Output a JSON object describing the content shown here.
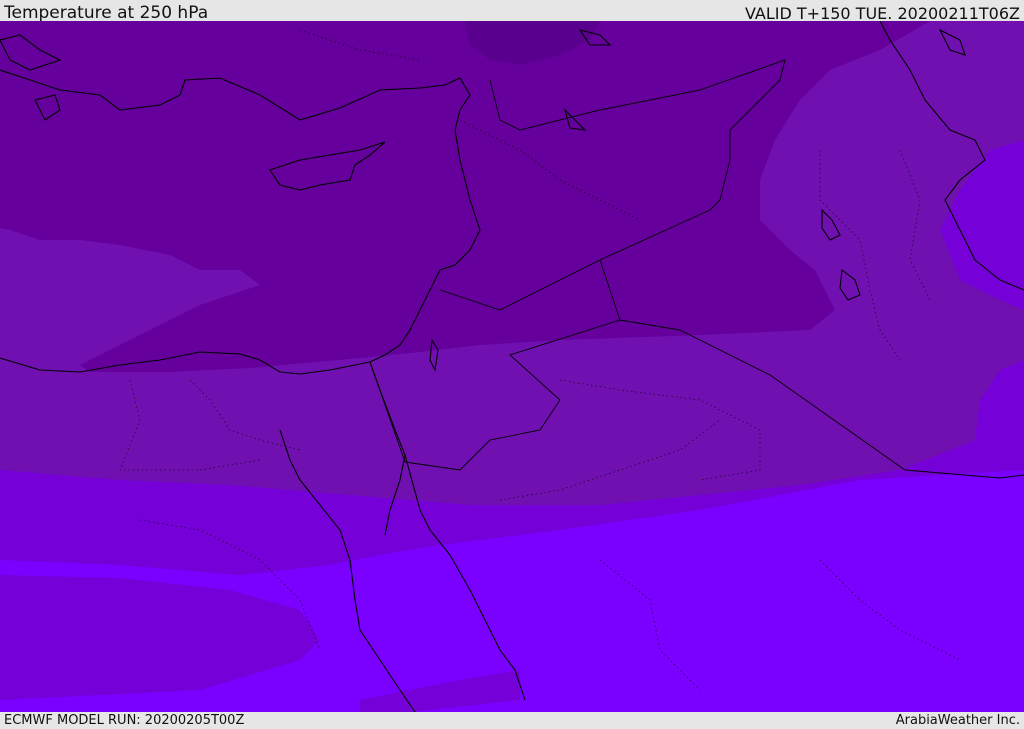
{
  "header": {
    "title": "Temperature at 250 hPa",
    "valid": "VALID T+150 TUE. 20200211T06Z"
  },
  "footer": {
    "model_run": "ECMWF MODEL RUN: 20200205T00Z",
    "credit": "ArabiaWeather Inc."
  },
  "colors": {
    "coldest_band": "#5a008f",
    "band_2": "#65009c",
    "band_3": "#7010b0",
    "band_4": "#7600d8",
    "warmest_band": "#7a00ff",
    "coastline": "#000000",
    "frame": "#e6e6e6"
  }
}
